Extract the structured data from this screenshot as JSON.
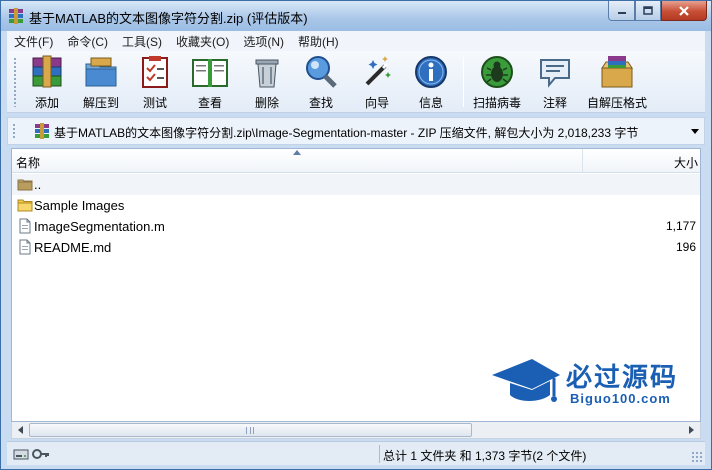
{
  "window": {
    "title": "基于MATLAB的文本图像字符分割.zip (评估版本)"
  },
  "menu": [
    {
      "label": "文件(F)"
    },
    {
      "label": "命令(C)"
    },
    {
      "label": "工具(S)"
    },
    {
      "label": "收藏夹(O)"
    },
    {
      "label": "选项(N)"
    },
    {
      "label": "帮助(H)"
    }
  ],
  "toolbar": {
    "add": "添加",
    "extract": "解压到",
    "test": "测试",
    "view": "查看",
    "delete": "删除",
    "find": "查找",
    "wizard": "向导",
    "info": "信息",
    "virus_scan": "扫描病毒",
    "comment": "注释",
    "sfx": "自解压格式"
  },
  "address": {
    "path": "基于MATLAB的文本图像字符分割.zip\\Image-Segmentation-master - ZIP 压缩文件, 解包大小为 2,018,233 字节"
  },
  "columns": {
    "name": "名称",
    "size": "大小"
  },
  "files": [
    {
      "name": "..",
      "size": "",
      "type": "parent"
    },
    {
      "name": "Sample Images",
      "size": "",
      "type": "folder"
    },
    {
      "name": "ImageSegmentation.m",
      "size": "1,177",
      "type": "file"
    },
    {
      "name": "README.md",
      "size": "196",
      "type": "file"
    }
  ],
  "watermark": {
    "main": "必过源码",
    "sub": "Biguo100.com"
  },
  "status": {
    "text": "总计 1 文件夹 和 1,373 字节(2 个文件)"
  },
  "colors": {
    "watermark": "#1a5fb3",
    "close_button": "#c74f36",
    "frame": "#c9dcf2"
  }
}
